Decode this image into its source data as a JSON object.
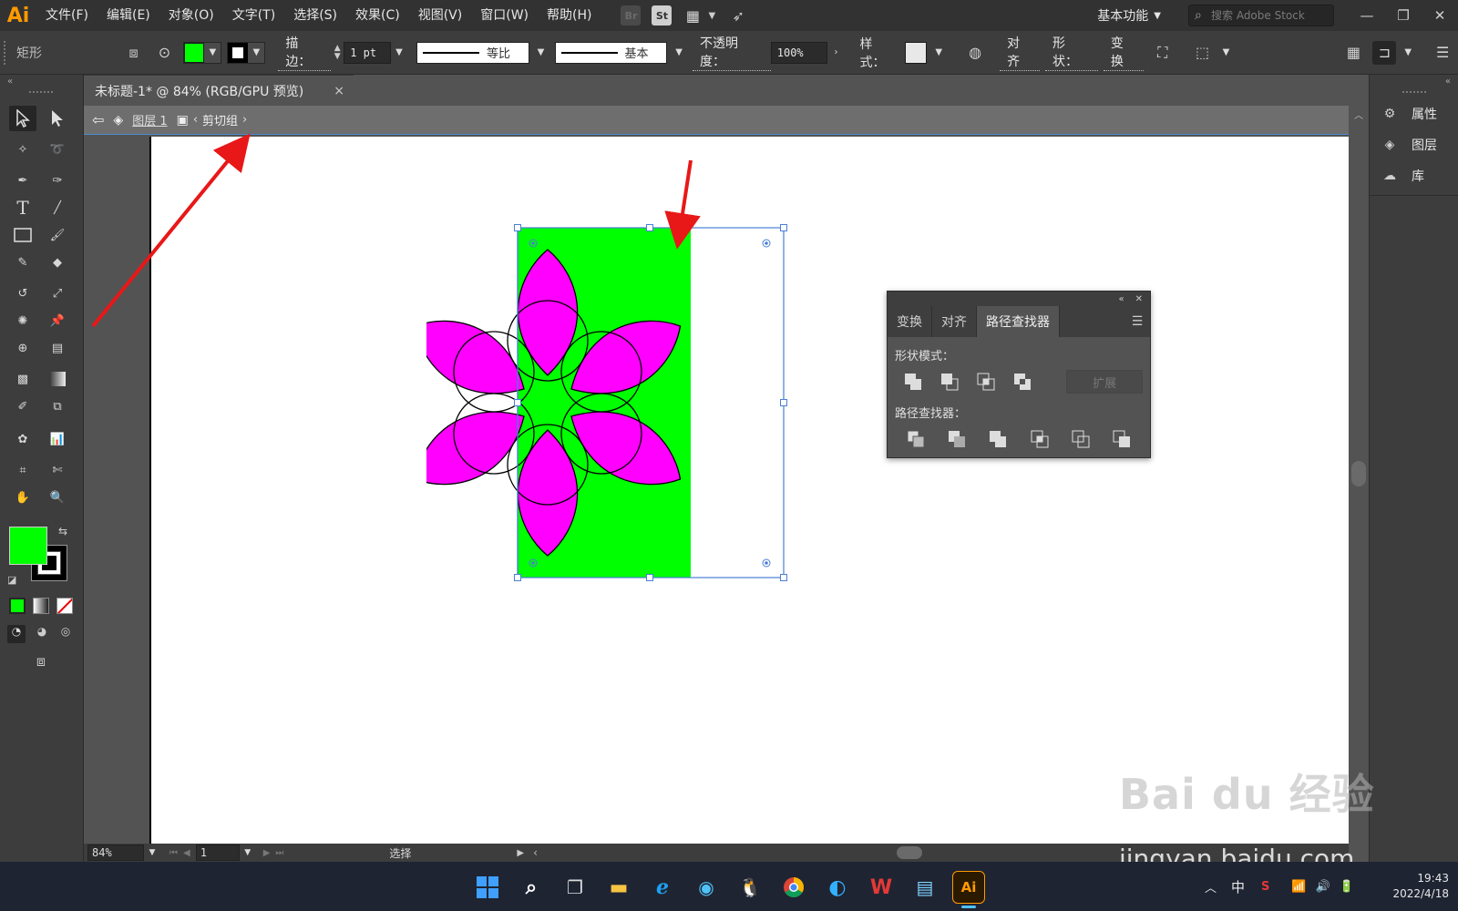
{
  "app": {
    "logo": "Ai",
    "menus": [
      "文件(F)",
      "编辑(E)",
      "对象(O)",
      "文字(T)",
      "选择(S)",
      "效果(C)",
      "视图(V)",
      "窗口(W)",
      "帮助(H)"
    ],
    "bridge_label": "Br",
    "stock_label": "St",
    "workspace": "基本功能",
    "search_placeholder": "搜索 Adobe Stock"
  },
  "control_bar": {
    "object_type": "矩形",
    "fill_color": "#00ff00",
    "stroke_label": "描边：",
    "stroke_weight": "1 pt",
    "stroke_profile": "等比",
    "brush": "基本",
    "opacity_label": "不透明度：",
    "opacity_value": "100%",
    "style_label": "样式：",
    "align_label": "对齐",
    "shape_label": "形状：",
    "transform_label": "变换"
  },
  "document": {
    "tab_title": "未标题-1* @ 84% (RGB/GPU 预览)",
    "close": "×",
    "breadcrumb_layer": "图层 1",
    "breadcrumb_group": "剪切组"
  },
  "right_panel": {
    "items": [
      "属性",
      "图层",
      "库"
    ]
  },
  "pathfinder": {
    "tabs": [
      "变换",
      "对齐",
      "路径查找器"
    ],
    "active_tab": "路径查找器",
    "shape_modes_label": "形状模式：",
    "pathfinders_label": "路径查找器：",
    "expand_label": "扩展"
  },
  "status_bar": {
    "zoom": "84%",
    "page": "1",
    "tool": "选择"
  },
  "taskbar": {
    "ime": "中",
    "time": "19:43",
    "date": "2022/4/18"
  },
  "watermark": {
    "brand": "Bai du 经验",
    "url": "jingyan.baidu.com"
  },
  "colors": {
    "accent_green": "#00ff00",
    "flower": "#ff00ff",
    "selection": "#4a7fd6",
    "arrow": "#e81818"
  }
}
